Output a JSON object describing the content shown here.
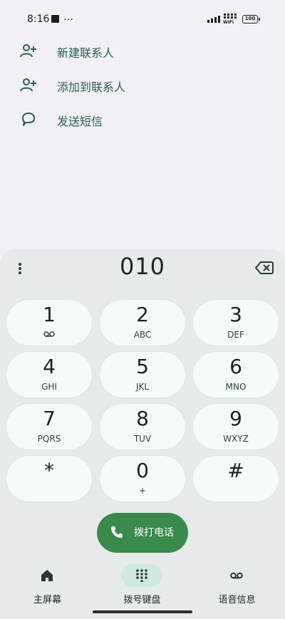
{
  "status_bar": {
    "time": "8:16",
    "more": "…",
    "wifi_label": "WiFi",
    "battery": "100"
  },
  "suggestions": [
    {
      "label": "新建联系人",
      "icon": "add-person-icon"
    },
    {
      "label": "添加到联系人",
      "icon": "add-person-icon"
    },
    {
      "label": "发送短信",
      "icon": "message-bubble-icon"
    }
  ],
  "dialer": {
    "number": "010",
    "keys": [
      {
        "digit": "1",
        "sub": ""
      },
      {
        "digit": "2",
        "sub": "ABC"
      },
      {
        "digit": "3",
        "sub": "DEF"
      },
      {
        "digit": "4",
        "sub": "GHI"
      },
      {
        "digit": "5",
        "sub": "JKL"
      },
      {
        "digit": "6",
        "sub": "MNO"
      },
      {
        "digit": "7",
        "sub": "PQRS"
      },
      {
        "digit": "8",
        "sub": "TUV"
      },
      {
        "digit": "9",
        "sub": "WXYZ"
      },
      {
        "digit": "*",
        "sub": ""
      },
      {
        "digit": "0",
        "sub": "+"
      },
      {
        "digit": "#",
        "sub": ""
      }
    ],
    "call_label": "拨打电话"
  },
  "nav": [
    {
      "label": "主屏幕",
      "icon": "home-icon",
      "active": false
    },
    {
      "label": "拨号键盘",
      "icon": "dialpad-icon",
      "active": true
    },
    {
      "label": "语音信息",
      "icon": "voicemail-icon",
      "active": false
    }
  ],
  "colors": {
    "accent": "#2a5f55",
    "call_button": "#3a8b4b",
    "key_background": "#f5fbf8",
    "sheet_background": "#e6eaea",
    "page_background": "#f1f0f6",
    "nav_active_pill": "#cfe8e3"
  }
}
